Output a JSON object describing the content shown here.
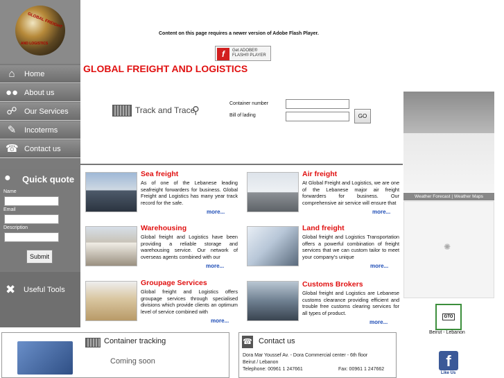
{
  "logo": {
    "arc_text": "GLOBAL FREIGHT",
    "sub_text": "AND LOGISTICS"
  },
  "flash": {
    "message": "Content on this page requires a newer version of Adobe Flash Player.",
    "button_line1": "Get ADOBE®",
    "button_line2": "FLASH® PLAYER"
  },
  "site_title": "GLOBAL FREIGHT AND LOGISTICS",
  "nav": [
    {
      "label": "Home",
      "icon": "home-icon"
    },
    {
      "label": "About us",
      "icon": "people-icon"
    },
    {
      "label": "Our Services",
      "icon": "cart-icon"
    },
    {
      "label": "Incoterms",
      "icon": "pen-icon"
    },
    {
      "label": "Contact us",
      "icon": "phone-icon"
    }
  ],
  "quick_quote": {
    "title": "Quick quote",
    "name_label": "Name",
    "email_label": "Email",
    "description_label": "Description",
    "submit_label": "Submit"
  },
  "useful_tools": "Useful Tools",
  "track": {
    "label": "Track and Trace",
    "container_label": "Container number",
    "bill_label": "Bill of lading",
    "go_label": "GO"
  },
  "weather": {
    "bar_text": "Weather Forecast | Weather Maps"
  },
  "gto": {
    "badge": "GTO",
    "label": "Beirut - Lebanon"
  },
  "facebook": {
    "label": "Like Us"
  },
  "services": [
    {
      "title": "Sea freight",
      "text": "As of one of the Lebanese leading seafreight forwarders for business. Global Freight and Logistics has many year track record for the safe.",
      "more": "more..."
    },
    {
      "title": "Air freight",
      "text": "At Global Freight and Logistics, we are one of the Lebanese major air freight forwarders for business. Our comprehensive air service will ensure that",
      "more": "more..."
    },
    {
      "title": "Warehousing",
      "text": "Global freight and Logistics have been providing a reliable storage and warehousing service. Our network of overseas agents combined with our",
      "more": "more..."
    },
    {
      "title": "Land freight",
      "text": "Global freight and Logistics Transportation offers a powerful combination of freight services that we can custom tailor to meet your company's unique",
      "more": "more..."
    },
    {
      "title": "Groupage Services",
      "text": "Global freight and Logistics offers groupage services through specialised divisions which provide clients an optimum level of service combined with",
      "more": "more..."
    },
    {
      "title": "Customs Brokers",
      "text": "Global freight and Logistics are Lebanese customs clearance providing efficient and trouble free customs clearing services for all types of product.",
      "more": "more..."
    }
  ],
  "container_tracking": {
    "title": "Container tracking",
    "status": "Coming soon"
  },
  "contact": {
    "title": "Contact us",
    "address1": "Dora Mar Youssef Av. - Dora Commercial center - 6th floor",
    "address2": "Beirut / Lebanon",
    "telephone": "Telephone: 00961 1 247661",
    "fax": "Fax: 00961 1 247662"
  }
}
